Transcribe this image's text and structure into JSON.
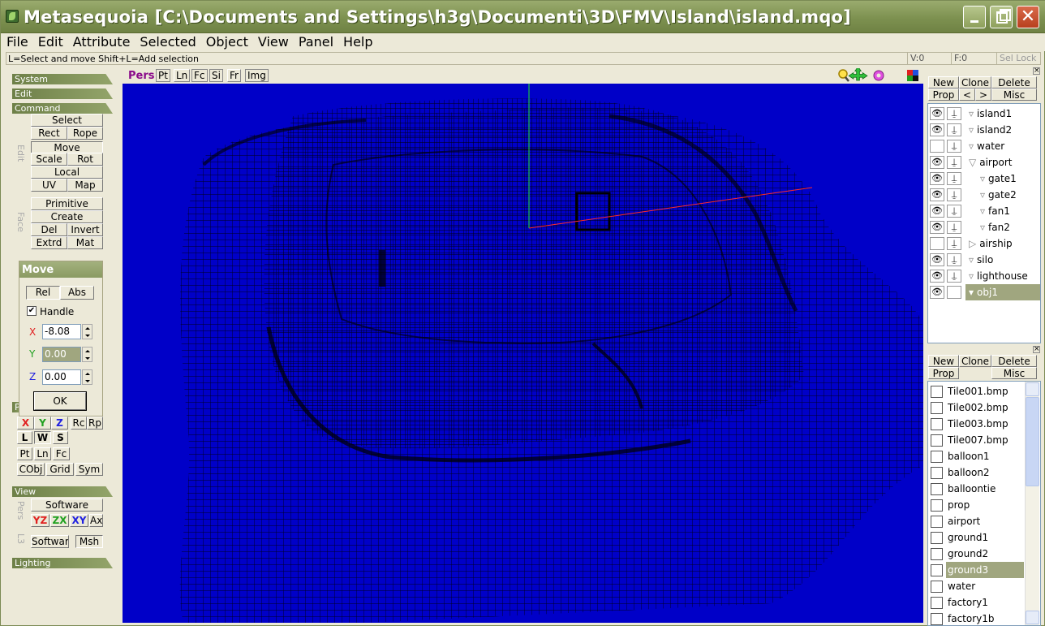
{
  "window": {
    "title": "Metasequoia [C:\\Documents and Settings\\h3g\\Documenti\\3D\\FMV\\Island\\island.mqo]",
    "min_label": "",
    "max_label": "",
    "close_label": "✕"
  },
  "menu": [
    "File",
    "Edit",
    "Attribute",
    "Selected",
    "Object",
    "View",
    "Panel",
    "Help"
  ],
  "status": {
    "hint": "L=Select and move  Shift+L=Add selection",
    "v": "V:0",
    "f": "F:0",
    "sel_lock": "Sel Lock"
  },
  "left": {
    "system": "System",
    "edit": "Edit",
    "command": "Command",
    "edit_side": "Edit",
    "face_side": "Face",
    "select": "Select",
    "rect": "Rect",
    "rope": "Rope",
    "move": "Move",
    "scale": "Scale",
    "rot": "Rot",
    "local": "Local",
    "uv": "UV",
    "map": "Map",
    "primitive": "Primitive",
    "create": "Create",
    "del": "Del",
    "invert": "Invert",
    "extrd": "Extrd",
    "mat": "Mat",
    "p_hdr": "P",
    "x": "X",
    "y": "Y",
    "z": "Z",
    "rc": "Rc",
    "rp": "Rp",
    "l": "L",
    "w": "W",
    "s": "S",
    "pt": "Pt",
    "ln": "Ln",
    "fc": "Fc",
    "cobj": "CObj",
    "grid": "Grid",
    "sym": "Sym",
    "view": "View",
    "pers_side": "Pers",
    "l3_side": "L3",
    "software": "Software",
    "yz": "YZ",
    "zx": "ZX",
    "xy": "XY",
    "ax": "Ax",
    "software2": "Software",
    "msh": "Msh",
    "lighting": "Lighting"
  },
  "move_panel": {
    "title": "Move",
    "rel": "Rel",
    "abs": "Abs",
    "handle_label": "Handle",
    "handle_checked": "✔",
    "x_label": "X",
    "x_value": "-8.08",
    "y_label": "Y",
    "y_value": "0.00",
    "z_label": "Z",
    "z_value": "0.00",
    "ok": "OK"
  },
  "viewport": {
    "mode": "Pers",
    "tabs": [
      "Pt",
      "Ln",
      "Fc",
      "Si",
      "Fr",
      "Img"
    ]
  },
  "objects_panel": {
    "new": "New",
    "clone": "Clone",
    "delete": "Delete",
    "prop": "Prop",
    "prev": "<",
    "next": ">",
    "misc": "Misc",
    "items": [
      {
        "name": "island1",
        "visible": "👁",
        "lock": "⍊",
        "indent": 0,
        "arrow": "▿"
      },
      {
        "name": "island2",
        "visible": "👁",
        "lock": "⍊",
        "indent": 0,
        "arrow": "▿"
      },
      {
        "name": "water",
        "visible": "",
        "lock": "⍊",
        "indent": 0,
        "arrow": "▿"
      },
      {
        "name": "airport",
        "visible": "👁",
        "lock": "⍊",
        "indent": 0,
        "arrow": "▽"
      },
      {
        "name": "gate1",
        "visible": "👁",
        "lock": "⍊",
        "indent": 1,
        "arrow": "▿"
      },
      {
        "name": "gate2",
        "visible": "👁",
        "lock": "⍊",
        "indent": 1,
        "arrow": "▿"
      },
      {
        "name": "fan1",
        "visible": "👁",
        "lock": "⍊",
        "indent": 1,
        "arrow": "▿"
      },
      {
        "name": "fan2",
        "visible": "👁",
        "lock": "⍊",
        "indent": 1,
        "arrow": "▿"
      },
      {
        "name": "airship",
        "visible": "",
        "lock": "⍊",
        "indent": 0,
        "arrow": "▷"
      },
      {
        "name": "silo",
        "visible": "👁",
        "lock": "⍊",
        "indent": 0,
        "arrow": "▿"
      },
      {
        "name": "lighthouse",
        "visible": "👁",
        "lock": "⍊",
        "indent": 0,
        "arrow": "▿"
      },
      {
        "name": "obj1",
        "visible": "👁",
        "lock": "",
        "indent": 0,
        "arrow": "▾"
      }
    ]
  },
  "materials_panel": {
    "new": "New",
    "clone": "Clone",
    "delete": "Delete",
    "prop": "Prop",
    "misc": "Misc",
    "items": [
      "Tile001.bmp",
      "Tile002.bmp",
      "Tile003.bmp",
      "Tile007.bmp",
      "balloon1",
      "balloon2",
      "balloontie",
      "prop",
      "airport",
      "ground1",
      "ground2",
      "ground3",
      "water",
      "factory1",
      "factory1b"
    ]
  },
  "colors": {
    "viewport_bg": "#0000c8",
    "titlebar": "#7d9150",
    "selection": "#a0a67f",
    "axis_x": "#ff2a2a",
    "axis_y": "#22ee22",
    "axis_z": "#2a2aff"
  }
}
